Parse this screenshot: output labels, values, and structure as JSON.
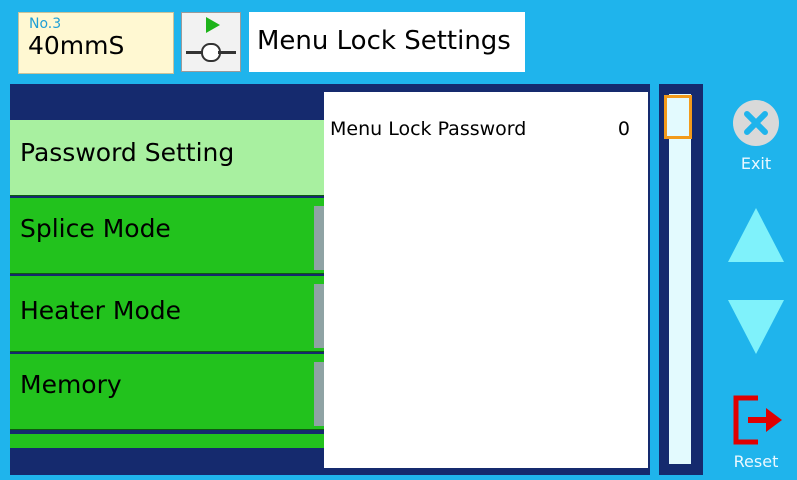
{
  "header": {
    "mode_number": "No.3",
    "mode_name": "40mmS",
    "title": "Menu Lock Settings",
    "splice_icon": "splice-start-icon"
  },
  "menu": {
    "items": [
      {
        "label": "Password Setting",
        "selected": true
      },
      {
        "label": "Splice Mode",
        "selected": false
      },
      {
        "label": "Heater Mode",
        "selected": false
      },
      {
        "label": "Memory",
        "selected": false
      }
    ]
  },
  "settings": {
    "rows": [
      {
        "label": "Menu Lock Password",
        "value": "0"
      }
    ]
  },
  "controls": {
    "exit_label": "Exit",
    "reset_label": "Reset",
    "up_icon": "triangle-up-icon",
    "down_icon": "triangle-down-icon"
  },
  "colors": {
    "background": "#1fb4ec",
    "panel": "#152a6e",
    "menu_item": "#22c21d",
    "menu_selected": "#a8f0a0",
    "scroll_thumb": "#f29a1b",
    "reset_icon": "#e00000",
    "arrow": "#7ff2fb"
  }
}
